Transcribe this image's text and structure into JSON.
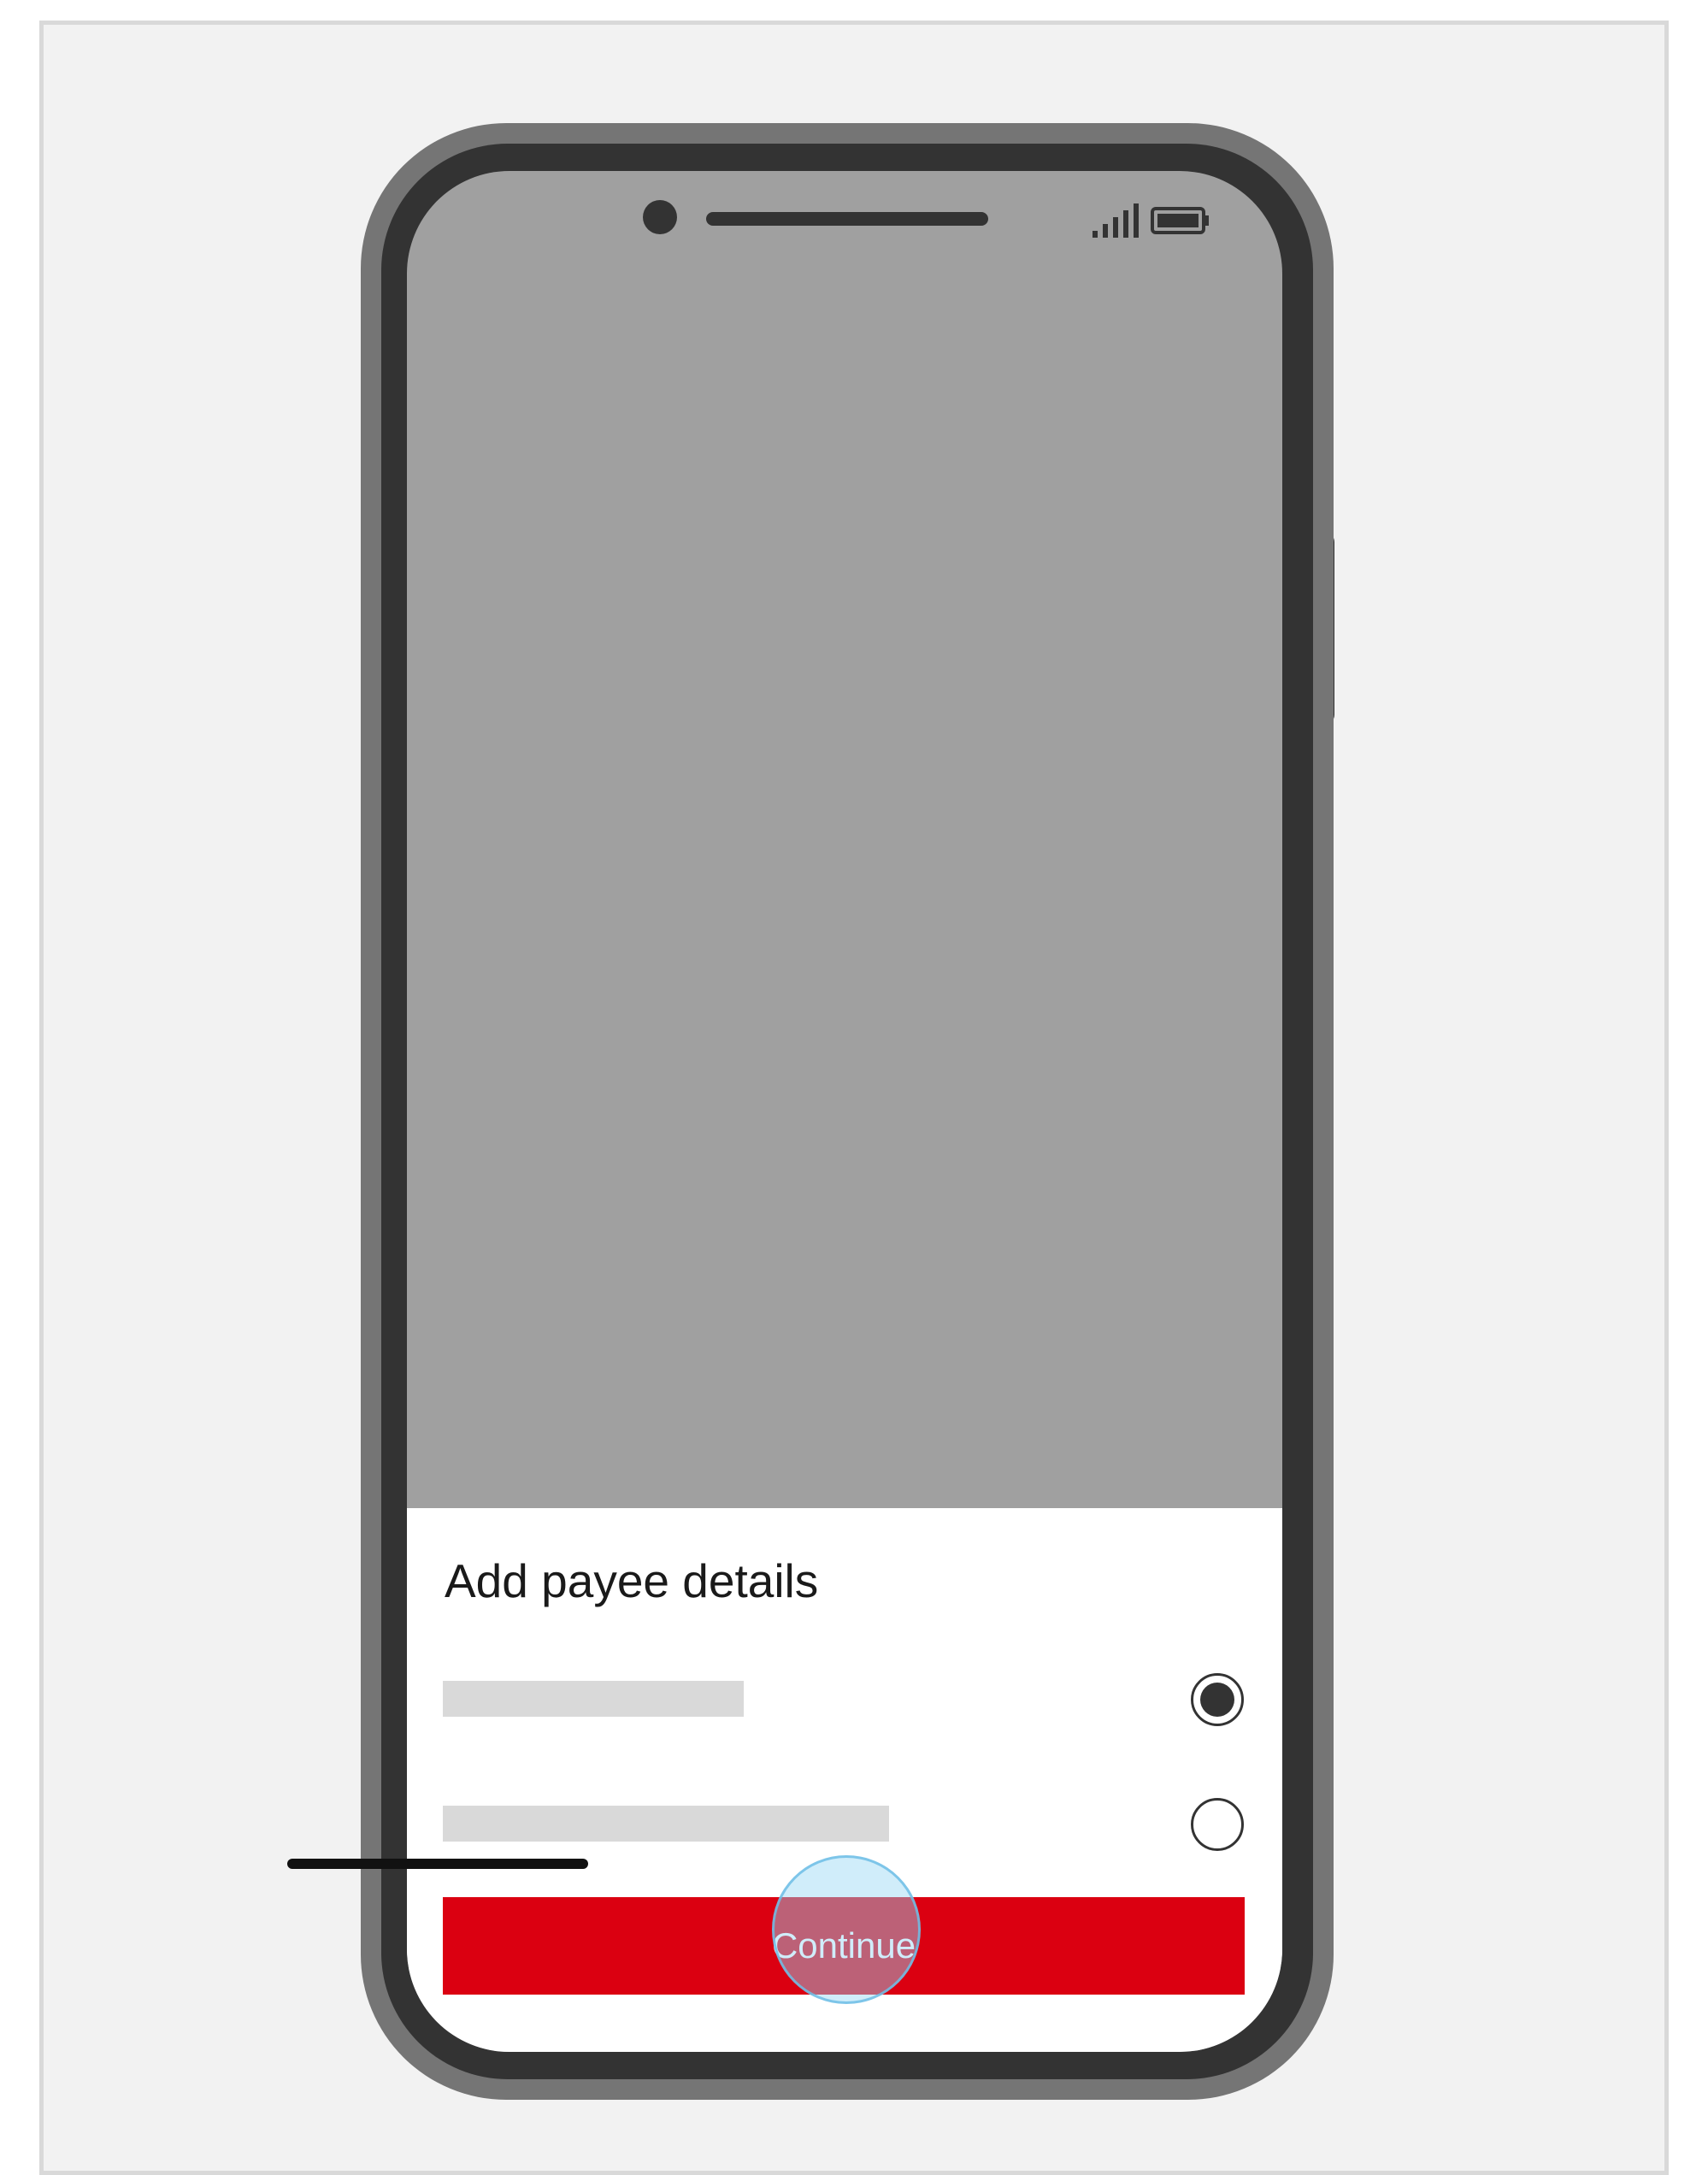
{
  "sheet": {
    "title": "Add payee details",
    "options": [
      {
        "selected": true
      },
      {
        "selected": false
      }
    ],
    "continue_label": "Continue"
  },
  "status_bar": {
    "icons": [
      "signal-icon",
      "battery-icon"
    ]
  },
  "colors": {
    "primary_button": "#db0011",
    "screen_overlay": "#a0a0a0",
    "phone_bezel": "#333333",
    "tap_indicator": "#96d7f5"
  }
}
